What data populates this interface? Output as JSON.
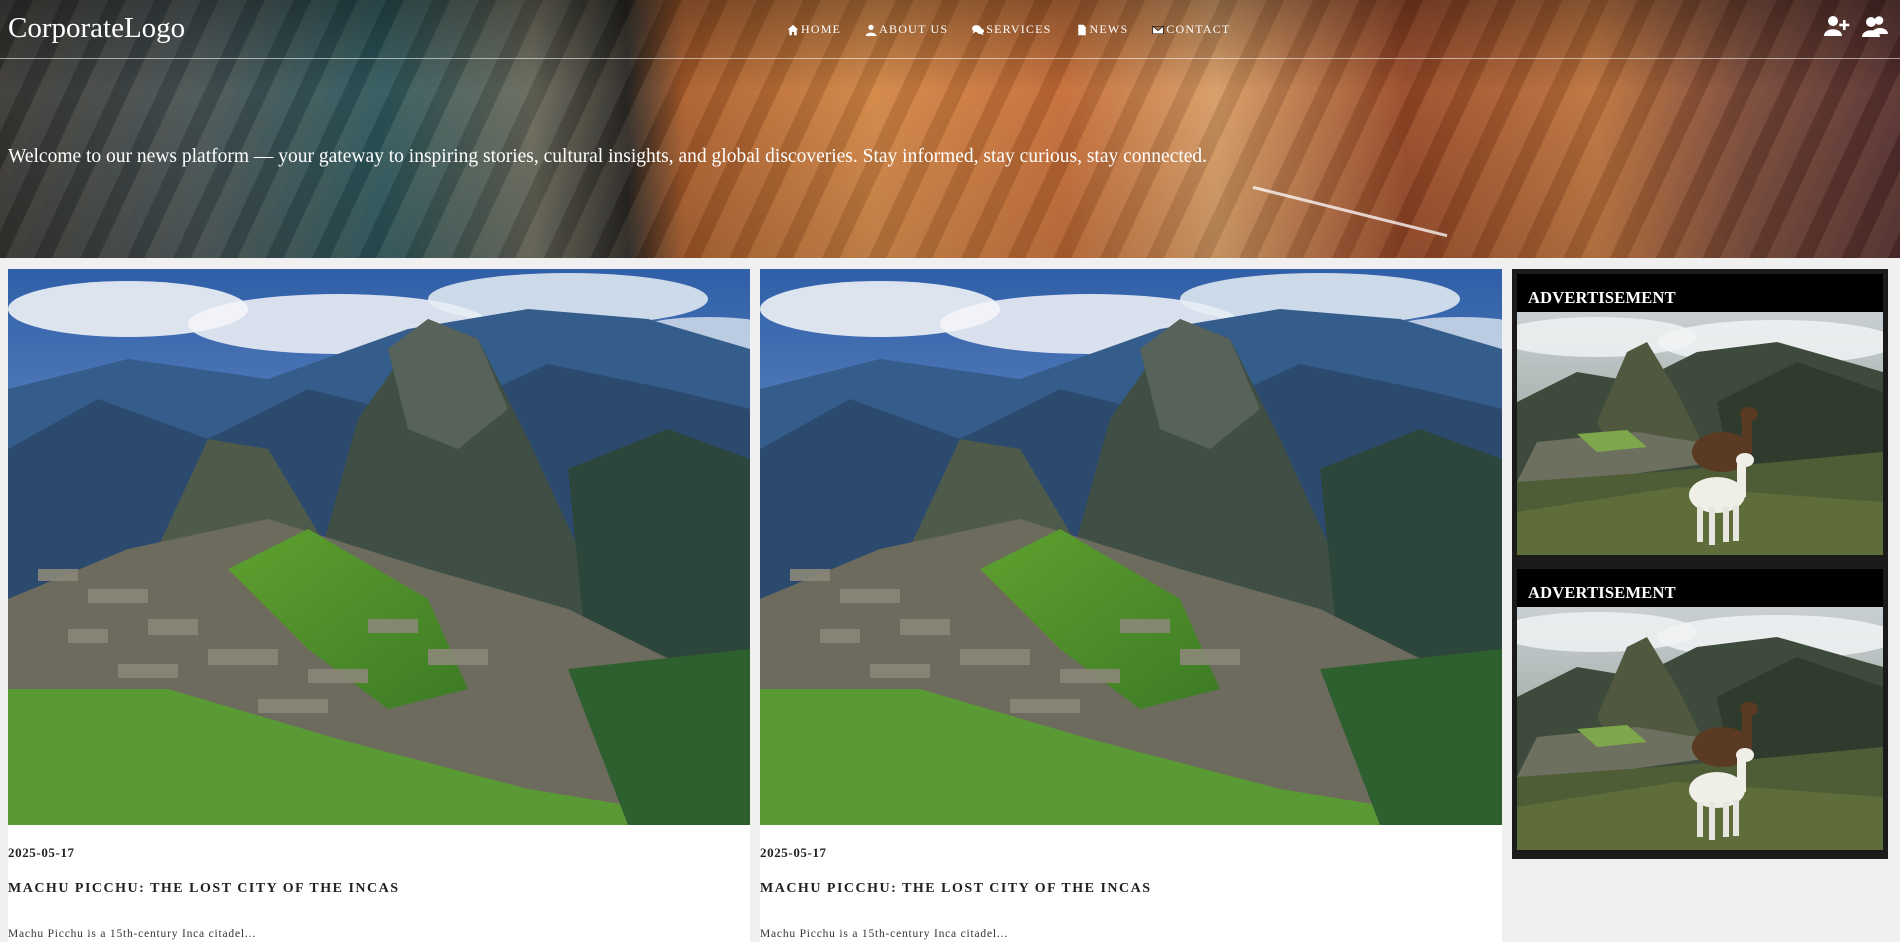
{
  "header": {
    "logo": "CorporateLogo",
    "nav": [
      {
        "label": "HOME",
        "icon": "home-icon"
      },
      {
        "label": "ABOUT US",
        "icon": "user-icon"
      },
      {
        "label": "SERVICES",
        "icon": "comments-icon"
      },
      {
        "label": "NEWS",
        "icon": "file-icon"
      },
      {
        "label": "CONTACT",
        "icon": "envelope-icon"
      }
    ],
    "account_icons": [
      "user-plus-icon",
      "users-icon"
    ]
  },
  "hero": {
    "tagline": "Welcome to our news platform — your gateway to inspiring stories, cultural insights, and global discoveries. Stay informed, stay curious, stay connected."
  },
  "articles": [
    {
      "date": "2025-05-17",
      "title": "MACHU PICCHU: THE LOST CITY OF THE INCAS",
      "excerpt": "Machu Picchu is a 15th-century Inca citadel...",
      "image": "machu-picchu-photo"
    },
    {
      "date": "2025-05-17",
      "title": "MACHU PICCHU: THE LOST CITY OF THE INCAS",
      "excerpt": "Machu Picchu is a 15th-century Inca citadel...",
      "image": "machu-picchu-photo"
    }
  ],
  "sidebar": {
    "ads": [
      {
        "label": "ADVERTISEMENT",
        "image": "machu-picchu-llamas-photo"
      },
      {
        "label": "ADVERTISEMENT",
        "image": "machu-picchu-llamas-photo"
      }
    ]
  },
  "colors": {
    "sidebar_bg": "#1b1b1b",
    "ad_header_bg": "#000000",
    "page_bg": "#f0f0f0"
  }
}
